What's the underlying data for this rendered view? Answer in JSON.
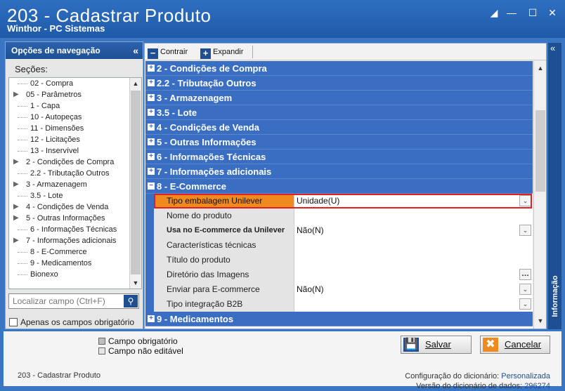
{
  "window": {
    "title": "203 - Cadastrar  Produto",
    "subtitle": "Winthor - PC Sistemas",
    "controls": [
      "restore-icon",
      "minimize-icon",
      "maximize-icon",
      "close-icon"
    ]
  },
  "nav": {
    "header": "Opções de navegação",
    "collapse_glyph": "«",
    "sections_label": "Seções:",
    "items": [
      {
        "label": "02 - Compra",
        "expandable": false
      },
      {
        "label": "05 - Parâmetros",
        "expandable": true
      },
      {
        "label": "1 - Capa",
        "expandable": false
      },
      {
        "label": "10 - Autopeças",
        "expandable": false
      },
      {
        "label": "11 - Dimensões",
        "expandable": false
      },
      {
        "label": "12 - Licitações",
        "expandable": false
      },
      {
        "label": "13 - Inservível",
        "expandable": false
      },
      {
        "label": "2 - Condições de Compra",
        "expandable": true
      },
      {
        "label": "2.2 - Tributação Outros",
        "expandable": false
      },
      {
        "label": "3 - Armazenagem",
        "expandable": true
      },
      {
        "label": "3.5 - Lote",
        "expandable": false
      },
      {
        "label": "4 - Condições de Venda",
        "expandable": true
      },
      {
        "label": "5 - Outras Informações",
        "expandable": true
      },
      {
        "label": "6 - Informações Técnicas",
        "expandable": false
      },
      {
        "label": "7 - Informações adicionais",
        "expandable": true
      },
      {
        "label": "8 - E-Commerce",
        "expandable": false
      },
      {
        "label": "9 - Medicamentos",
        "expandable": false
      },
      {
        "label": "Bionexo",
        "expandable": false
      }
    ],
    "search_placeholder": "Localizar campo (Ctrl+F)",
    "required_only_label": "Apenas os campos obrigatório"
  },
  "toolbar": {
    "collapse_label": "Contrair",
    "expand_label": "Expandir"
  },
  "groups_before": [
    "2 - Condições de Compra",
    "2.2 - Tributação Outros",
    "3 - Armazenagem",
    "3.5 - Lote",
    "4 - Condições de Venda",
    "5 - Outras Informações",
    "6 - Informações Técnicas",
    "7 - Informações adicionais"
  ],
  "open_group": {
    "title": "8 - E-Commerce",
    "rows": [
      {
        "label": "Tipo embalagem Unilever",
        "value": "Unidade(U)",
        "editor": "dropdown",
        "highlight": true,
        "bold": false
      },
      {
        "label": "Nome do produto",
        "value": "",
        "editor": "text",
        "highlight": false,
        "bold": false
      },
      {
        "label": "Usa no E-commerce da Unilever",
        "value": "Não(N)",
        "editor": "dropdown",
        "highlight": false,
        "bold": true
      },
      {
        "label": "Características técnicas",
        "value": "",
        "editor": "text",
        "highlight": false,
        "bold": false
      },
      {
        "label": "Título do produto",
        "value": "",
        "editor": "text",
        "highlight": false,
        "bold": false
      },
      {
        "label": "Diretório das Imagens",
        "value": "",
        "editor": "ellipsis",
        "highlight": false,
        "bold": false
      },
      {
        "label": "Enviar para E-commerce",
        "value": "Não(N)",
        "editor": "dropdown",
        "highlight": false,
        "bold": false
      },
      {
        "label": "Tipo integração B2B",
        "value": "",
        "editor": "dropdown",
        "highlight": false,
        "bold": false
      }
    ]
  },
  "group_after": "9 - Medicamentos",
  "info_panel": {
    "label": "Informação",
    "collapse_glyph": "«"
  },
  "legend": {
    "required": "Campo obrigatório",
    "not_editable": "Campo não editável",
    "required_color": "#bdbdbd",
    "not_editable_color": "#e4e4e4"
  },
  "buttons": {
    "save": "Salvar",
    "cancel": "Cancelar"
  },
  "status": {
    "left": "203 - Cadastrar  Produto",
    "dict_config_label": "Configuração do dicionário:",
    "dict_config_value": "Personalizada",
    "dict_version_label": "Versão do dicionário de dados:",
    "dict_version_value": "296274"
  },
  "colors": {
    "group_header": "#3a6ec2",
    "highlight_label": "#f0891e",
    "highlight_border": "#e02020",
    "accent": "#1e4f92"
  }
}
